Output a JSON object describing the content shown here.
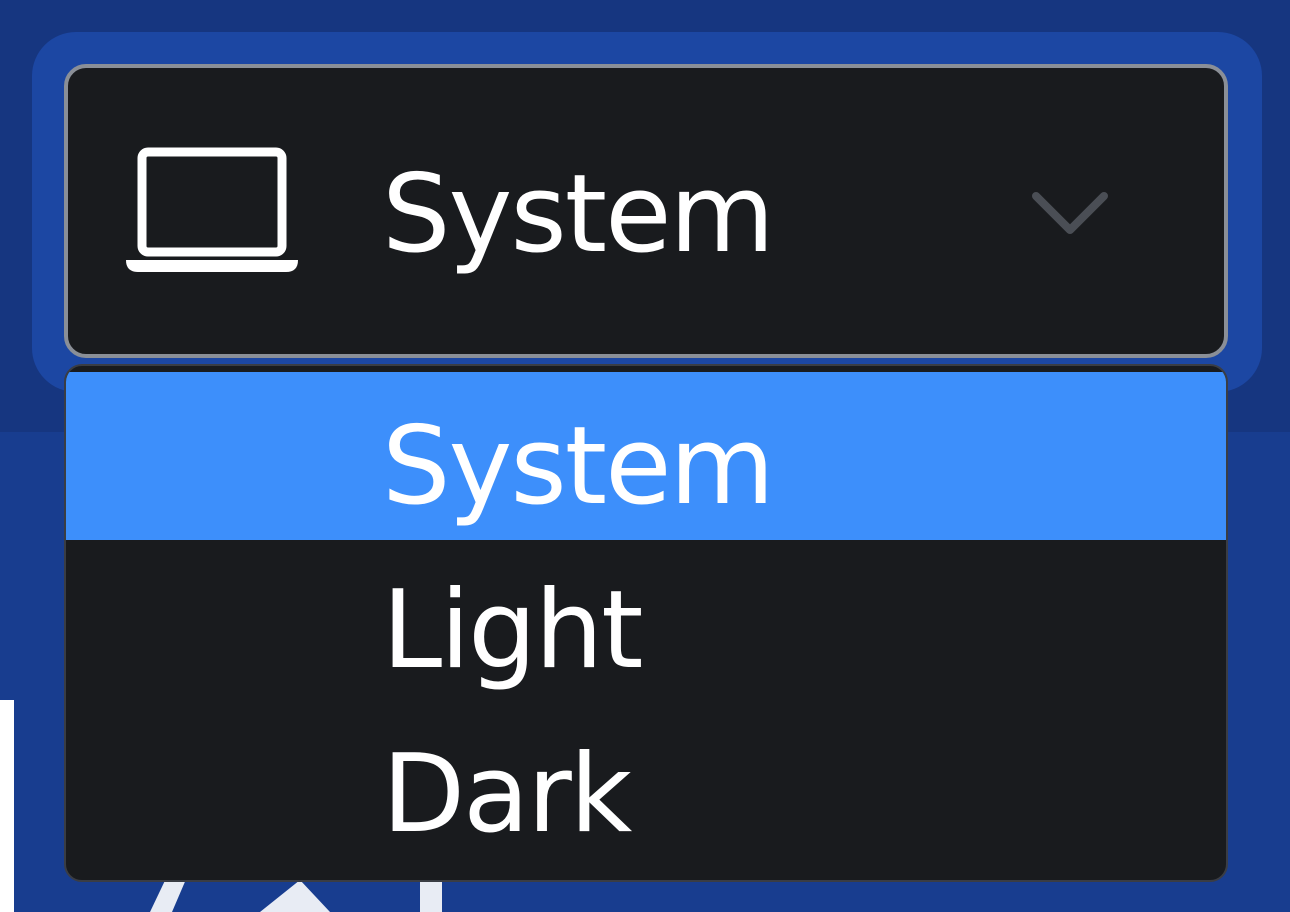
{
  "theme_select": {
    "current_value": "System",
    "icon": "laptop-icon",
    "chevron": "chevron-down-icon",
    "options": [
      {
        "label": "System",
        "selected": true
      },
      {
        "label": "Light",
        "selected": false
      },
      {
        "label": "Dark",
        "selected": false
      }
    ]
  },
  "colors": {
    "background": "#173a8c",
    "focus_ring": "#1c47a3",
    "select_bg": "#191b1e",
    "select_border": "#8a8f97",
    "highlight": "#3d8ffb",
    "text": "#ffffff",
    "chevron": "#4a4e55"
  }
}
